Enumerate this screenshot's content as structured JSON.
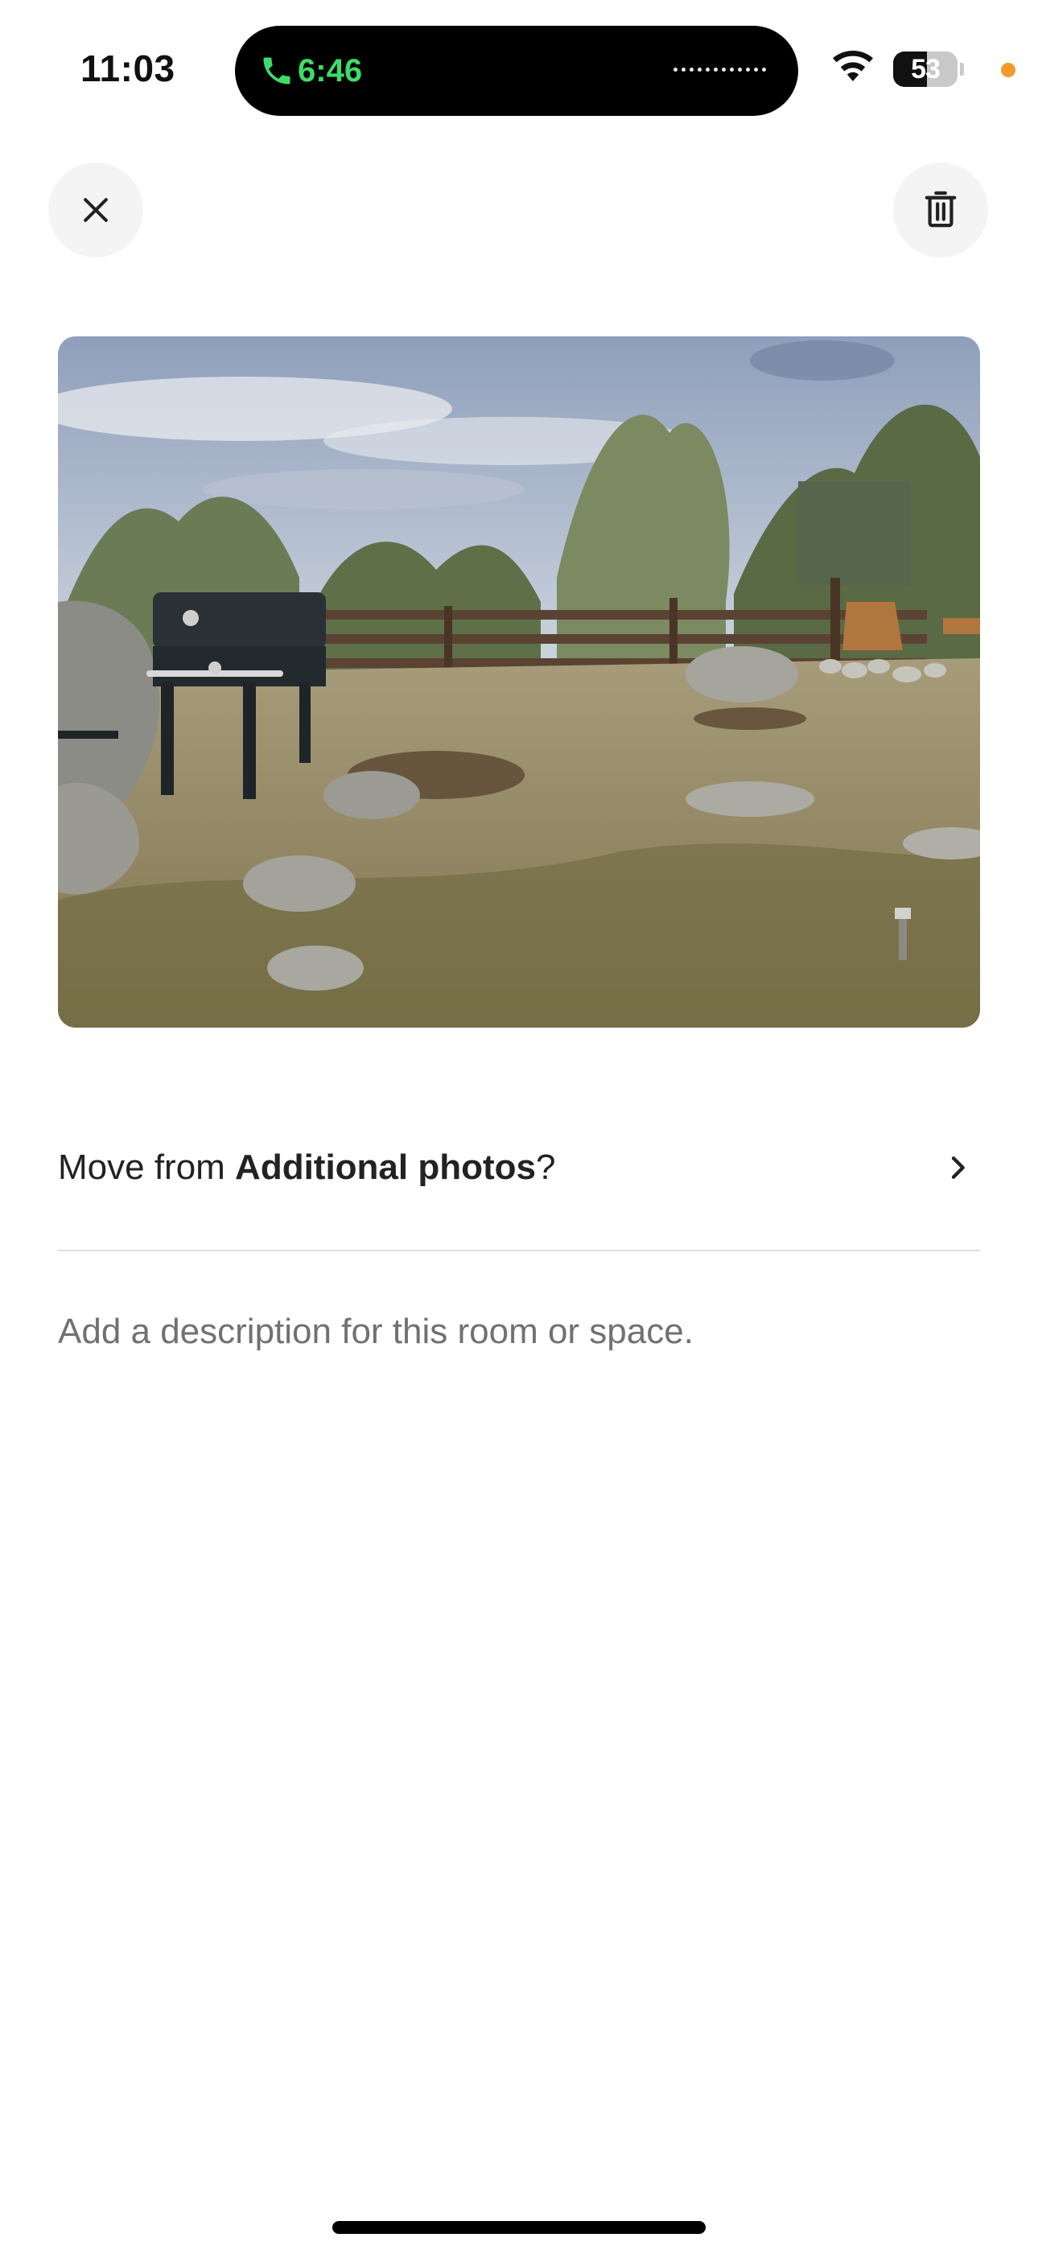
{
  "status_bar": {
    "time": "11:03",
    "call_duration": "6:46",
    "battery_level": "53",
    "call_color": "#3ddc6a",
    "privacy_dot_color": "#f19a2a",
    "call_icon": "phone-icon",
    "wifi_icon": "wifi-icon"
  },
  "toolbar": {
    "close_icon": "close-icon",
    "delete_icon": "trash-icon"
  },
  "photo": {
    "subject": "backyard-grill-photo"
  },
  "move_row": {
    "prefix": "Move from ",
    "album": "Additional photos",
    "suffix": "?",
    "chevron_icon": "chevron-right-icon"
  },
  "description": {
    "placeholder": "Add a description for this room or space."
  }
}
